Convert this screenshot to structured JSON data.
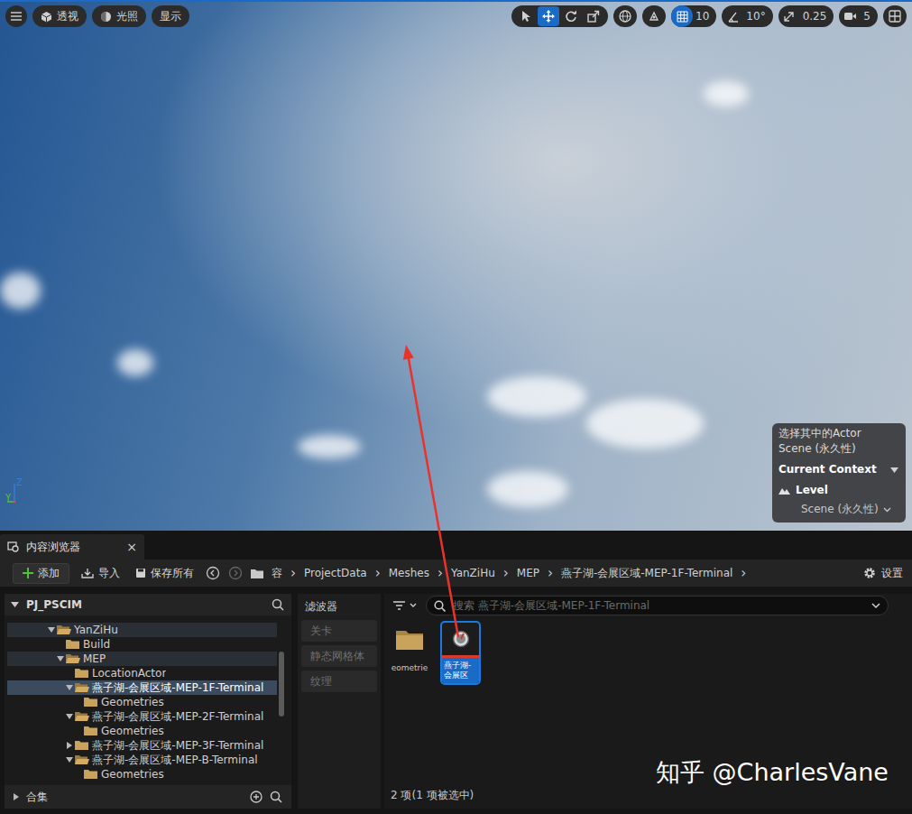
{
  "viewport": {
    "left_buttons": [
      {
        "label": "透视",
        "kind": "perspective"
      },
      {
        "label": "光照",
        "kind": "lighting"
      },
      {
        "label": "显示",
        "kind": "show"
      }
    ],
    "transform_tools": [
      {
        "kind": "select",
        "selected": false
      },
      {
        "kind": "move",
        "selected": true
      },
      {
        "kind": "rotate",
        "selected": false
      },
      {
        "kind": "scale",
        "selected": false
      }
    ],
    "snaps": [
      {
        "kind": "grid",
        "value": "10",
        "active": true
      },
      {
        "kind": "angle",
        "value": "10°",
        "active": false
      },
      {
        "kind": "scale",
        "value": "0.25",
        "active": false
      },
      {
        "kind": "camera",
        "value": "5",
        "active": false
      }
    ],
    "gizmo_labels": [
      "Y",
      "Z"
    ],
    "context_panel": {
      "title": "选择其中的Actor",
      "subtitle": "Scene (永久性)",
      "header": "Current Context",
      "level_label": "Level",
      "level_value": "Scene (永久性)"
    }
  },
  "tab": {
    "label": "内容浏览器",
    "close": "×"
  },
  "toolbar": {
    "add": "添加",
    "import": "导入",
    "save_all": "保存所有",
    "separator": "›",
    "breadcrumbs": [
      "容",
      "ProjectData",
      "Meshes",
      "YanZiHu",
      "MEP",
      "燕子湖-会展区域-MEP-1F-Terminal"
    ],
    "settings": "设置"
  },
  "tree": {
    "root": "PJ_PSCIM",
    "collections": "合集",
    "items": [
      {
        "label": "YanZiHu",
        "depth": 3,
        "expandable": true,
        "expanded": true,
        "selected": false,
        "highlighted": true
      },
      {
        "label": "Build",
        "depth": 4,
        "expandable": false,
        "expanded": false,
        "selected": false,
        "highlighted": false
      },
      {
        "label": "MEP",
        "depth": 4,
        "expandable": true,
        "expanded": true,
        "selected": false,
        "highlighted": true
      },
      {
        "label": "LocationActor",
        "depth": 5,
        "expandable": false,
        "expanded": false,
        "selected": false,
        "highlighted": false
      },
      {
        "label": "燕子湖-会展区域-MEP-1F-Terminal",
        "depth": 5,
        "expandable": true,
        "expanded": true,
        "selected": true,
        "highlighted": false
      },
      {
        "label": "Geometries",
        "depth": 6,
        "expandable": false,
        "expanded": false,
        "selected": false,
        "highlighted": false
      },
      {
        "label": "燕子湖-会展区域-MEP-2F-Terminal",
        "depth": 5,
        "expandable": true,
        "expanded": true,
        "selected": false,
        "highlighted": false
      },
      {
        "label": "Geometries",
        "depth": 6,
        "expandable": false,
        "expanded": false,
        "selected": false,
        "highlighted": false
      },
      {
        "label": "燕子湖-会展区域-MEP-3F-Terminal",
        "depth": 5,
        "expandable": true,
        "expanded": false,
        "selected": false,
        "highlighted": false
      },
      {
        "label": "燕子湖-会展区域-MEP-B-Terminal",
        "depth": 5,
        "expandable": true,
        "expanded": true,
        "selected": false,
        "highlighted": false
      },
      {
        "label": "Geometries",
        "depth": 6,
        "expandable": false,
        "expanded": false,
        "selected": false,
        "highlighted": false
      }
    ]
  },
  "filters": {
    "title": "滤波器",
    "items": [
      "关卡",
      "静态网格体",
      "纹理"
    ]
  },
  "assets": {
    "search_placeholder": "搜索 燕子湖-会展区域-MEP-1F-Terminal",
    "items": [
      {
        "kind": "folder",
        "label": "eometrie",
        "selected": false
      },
      {
        "kind": "level",
        "label": "燕子湖-会展区",
        "selected": true
      }
    ],
    "status": "2 项(1 项被选中)"
  },
  "watermark": "知乎 @CharlesVane"
}
